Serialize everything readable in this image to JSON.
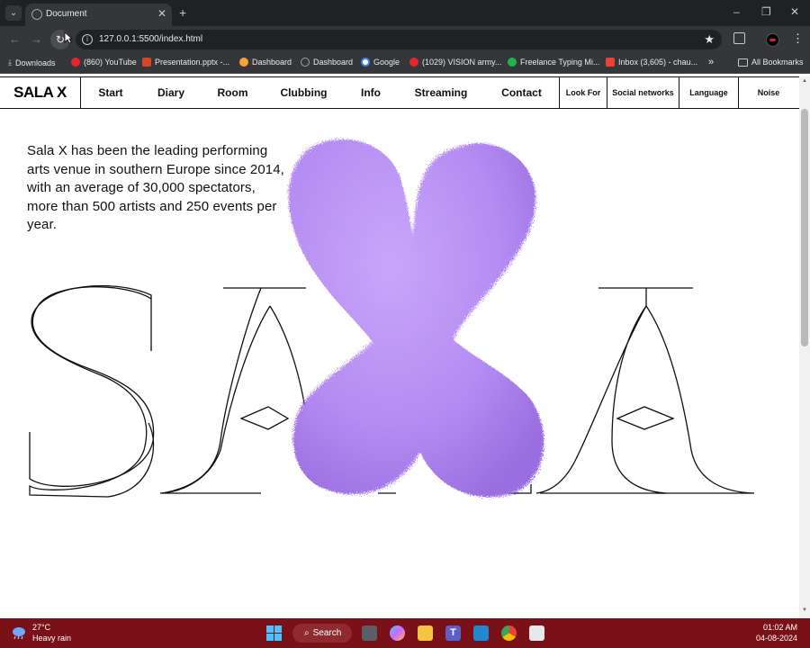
{
  "browser": {
    "tab_title": "Document",
    "url": "127.0.0.1:5500/index.html",
    "bookmarks": [
      {
        "label": "Downloads",
        "color": "#c8c9cc"
      },
      {
        "label": "(860) YouTube",
        "color": "#e3262f"
      },
      {
        "label": "Presentation.pptx -...",
        "color": "#d24726"
      },
      {
        "label": "Dashboard",
        "color": "#f2a33a"
      },
      {
        "label": "Dashboard",
        "color": "#9aa0a6"
      },
      {
        "label": "Google",
        "color": "#4285f4"
      },
      {
        "label": "(1029) VISION army...",
        "color": "#e3262f"
      },
      {
        "label": "Freelance Typing Mi...",
        "color": "#22b14c"
      },
      {
        "label": "Inbox (3,605) - chau...",
        "color": "#ea4335"
      }
    ],
    "all_bookmarks": "All Bookmarks"
  },
  "site": {
    "logo": "SALA X",
    "nav": [
      "Start",
      "Diary",
      "Room",
      "Clubbing",
      "Info",
      "Streaming",
      "Contact"
    ],
    "nav_side": [
      "Look For",
      "Social networks",
      "Language",
      "Noise"
    ],
    "hero_text": "Sala X has been the leading performing arts venue in southern Europe since 2014, with an average of 30,000 spectators, more than 500 artists and 250 events per year.",
    "accent_color": "#b58cf2"
  },
  "taskbar": {
    "temperature": "27°C",
    "weather": "Heavy rain",
    "search_label": "Search",
    "time": "01:02 AM",
    "date": "04-08-2024"
  }
}
